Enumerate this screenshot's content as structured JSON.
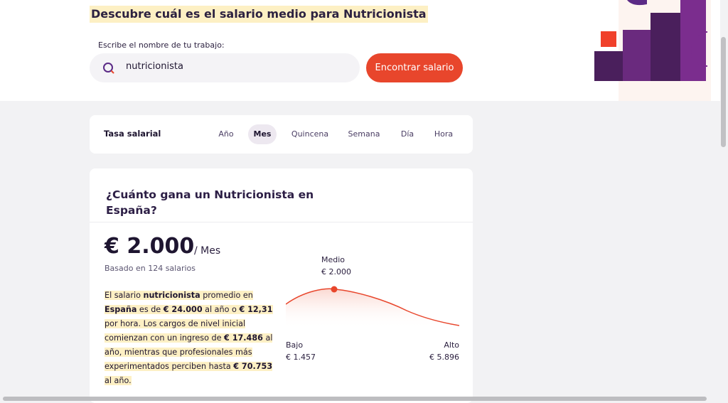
{
  "hero": {
    "title": "Descubre cuál es el salario medio para Nutricionista",
    "search_label": "Escribe el nombre de tu trabajo:",
    "search_value": "nutricionista",
    "button_label": "Encontrar salario"
  },
  "rate": {
    "title": "Tasa salarial",
    "tabs": [
      "Año",
      "Mes",
      "Quincena",
      "Semana",
      "Día",
      "Hora"
    ],
    "active": "Mes"
  },
  "main": {
    "question": "¿Cuánto gana un Nutricionista en España?",
    "salary": "€ 2.000",
    "period": "/ Mes",
    "based_on": "Basado en 124 salarios",
    "desc": {
      "t1": "El salario ",
      "job": "nutricionista",
      "t2": " promedio en ",
      "country": "España",
      "t3": " es de ",
      "annual": "€ 24.000",
      "t4": " al año o ",
      "hourly": "€ 12,31",
      "t5": " por hora. Los cargos de nivel inicial comienzan con un ingreso de ",
      "entry": "€ 17.486",
      "t6": " al año, mientras que profesionales más experimentados perciben hasta ",
      "top": "€ 70.753",
      "t7": " al año."
    },
    "chart": {
      "medio_label": "Medio",
      "medio_value": "€ 2.000",
      "bajo_label": "Bajo",
      "bajo_value": "€ 1.457",
      "alto_label": "Alto",
      "alto_value": "€ 5.896"
    }
  },
  "colors": {
    "accent": "#e8462c",
    "highlight": "#fdf0c4",
    "purple_dark": "#4a1f5c",
    "purple": "#7b2d8e"
  }
}
